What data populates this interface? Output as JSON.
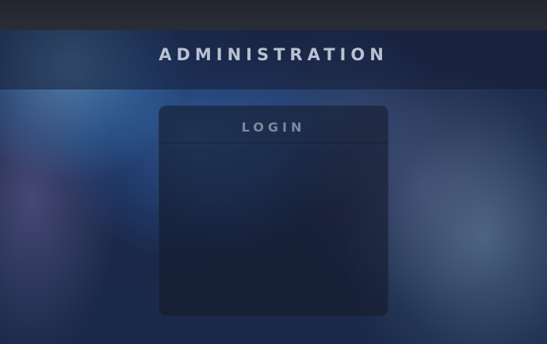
{
  "header": {
    "title": "ADMINISTRATION"
  },
  "login_panel": {
    "title": "LOGIN"
  }
}
